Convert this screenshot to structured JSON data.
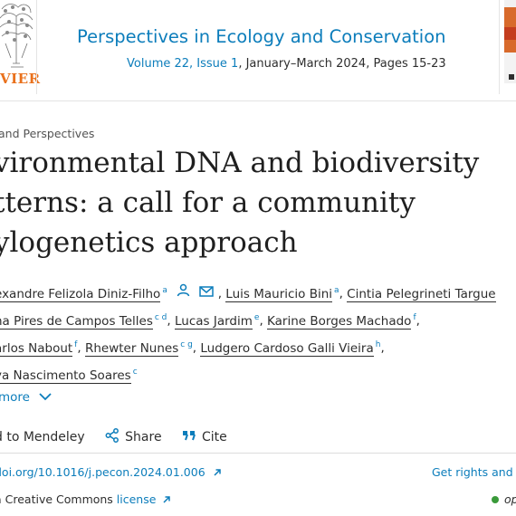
{
  "header": {
    "publisher_logo_text": "VIER",
    "journal_title": "Perspectives in Ecology and Conservation",
    "issue_link": "Volume 22, Issue 1",
    "issue_rest": ", January–March 2024, Pages 15-23"
  },
  "article": {
    "type": "and Perspectives",
    "title_lines": [
      "vironmental DNA and biodiversity",
      "tterns: a call for a community",
      "ylogenetics approach"
    ]
  },
  "authors": {
    "line1": [
      {
        "name": "exandre Felizola Diniz-Filho",
        "sup": "a"
      },
      {
        "name": "Luis Mauricio Bini",
        "sup": "a"
      },
      {
        "name": "Cintia Pelegrineti Targue",
        "sup": ""
      }
    ],
    "line2": [
      {
        "name": "na Pires de Campos Telles",
        "sup": "c d"
      },
      {
        "name": "Lucas Jardim",
        "sup": "e"
      },
      {
        "name": "Karine Borges Machado",
        "sup": "f"
      }
    ],
    "line3": [
      {
        "name": "arlos Nabout",
        "sup": "f"
      },
      {
        "name": "Rhewter Nunes",
        "sup": "c g"
      },
      {
        "name": "Ludgero Cardoso Galli Vieira",
        "sup": "h"
      }
    ],
    "line4": [
      {
        "name": "ya Nascimento Soares",
        "sup": "c"
      }
    ]
  },
  "show_more": "more",
  "actions": {
    "mendeley": "d to Mendeley",
    "share": "Share",
    "cite": "Cite"
  },
  "links": {
    "doi": "doi.org/10.1016/j.pecon.2024.01.006",
    "rights": "Get rights and c",
    "license_prefix": "a Creative Commons ",
    "license_link": "license",
    "open_access": "op"
  },
  "colors": {
    "link_blue": "#0c7dbb",
    "elsevier_orange": "#e9711c",
    "open_access_green": "#3a9a3a"
  }
}
